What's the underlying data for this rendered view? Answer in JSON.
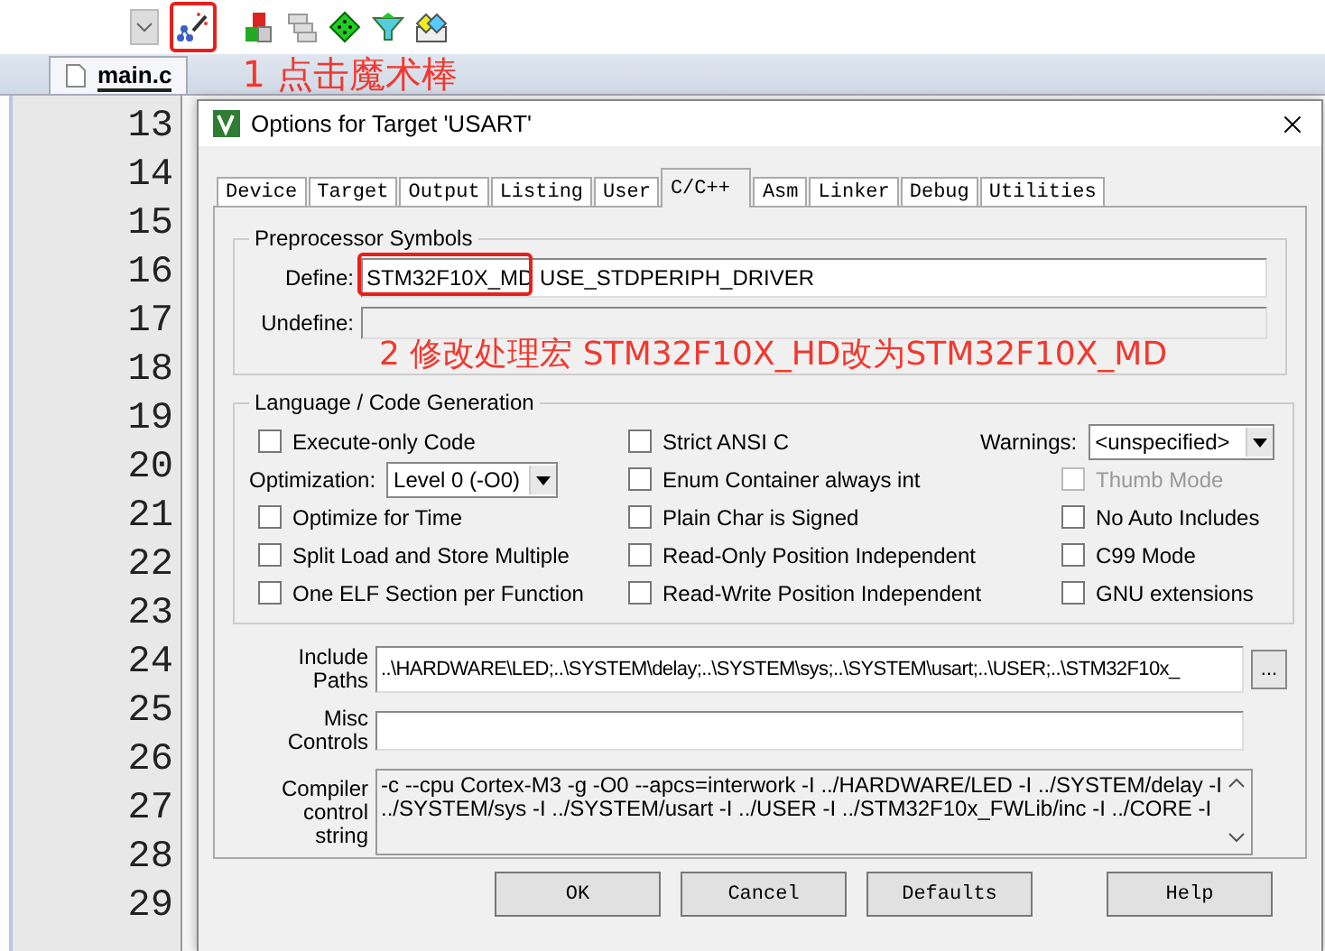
{
  "toolbar": {
    "wand_highlighted": true
  },
  "editor_tabs": [
    {
      "label": "main.c",
      "selected": true
    }
  ],
  "annotations": [
    {
      "text": "1 点击魔术棒"
    },
    {
      "text": "2 修改处理宏 STM32F10X_HD改为STM32F10X_MD"
    }
  ],
  "line_numbers": [
    "13",
    "14",
    "15",
    "16",
    "17",
    "18",
    "19",
    "20",
    "21",
    "22",
    "23",
    "24",
    "25",
    "26",
    "27",
    "28",
    "29"
  ],
  "dialog": {
    "title": "Options for Target 'USART'",
    "tabs": [
      {
        "label": "Device",
        "selected": false
      },
      {
        "label": "Target",
        "selected": false
      },
      {
        "label": "Output",
        "selected": false
      },
      {
        "label": "Listing",
        "selected": false
      },
      {
        "label": "User",
        "selected": false
      },
      {
        "label": "C/C++",
        "selected": true
      },
      {
        "label": "Asm",
        "selected": false
      },
      {
        "label": "Linker",
        "selected": false
      },
      {
        "label": "Debug",
        "selected": false
      },
      {
        "label": "Utilities",
        "selected": false
      }
    ],
    "preprocessor": {
      "title": "Preprocessor Symbols",
      "define_label": "Define:",
      "define_value": "STM32F10X_MD USE_STDPERIPH_DRIVER",
      "define_highlighted": true,
      "undefine_label": "Undefine:"
    },
    "language": {
      "title": "Language / Code Generation",
      "columns": [
        [
          {
            "kind": "checkbox",
            "label": "Execute-only Code",
            "checked": false,
            "disabled": false
          },
          {
            "kind": "select",
            "label": "Optimization:",
            "value": "Level 0 (-O0)"
          },
          {
            "kind": "checkbox",
            "label": "Optimize for Time",
            "checked": false,
            "disabled": false
          },
          {
            "kind": "checkbox",
            "label": "Split Load and Store Multiple",
            "checked": false,
            "disabled": false
          },
          {
            "kind": "checkbox",
            "label": "One ELF Section per Function",
            "checked": false,
            "disabled": false
          }
        ],
        [
          {
            "kind": "checkbox",
            "label": "Strict ANSI C",
            "checked": false,
            "disabled": false
          },
          {
            "kind": "checkbox",
            "label": "Enum Container always int",
            "checked": false,
            "disabled": false
          },
          {
            "kind": "checkbox",
            "label": "Plain Char is Signed",
            "checked": false,
            "disabled": false
          },
          {
            "kind": "checkbox",
            "label": "Read-Only Position Independent",
            "checked": false,
            "disabled": false
          },
          {
            "kind": "checkbox",
            "label": "Read-Write Position Independent",
            "checked": false,
            "disabled": false
          }
        ],
        [
          {
            "kind": "select",
            "label": "Warnings:",
            "value": "<unspecified>"
          },
          {
            "kind": "checkbox",
            "label": "Thumb Mode",
            "checked": false,
            "disabled": true
          },
          {
            "kind": "checkbox",
            "label": "No Auto Includes",
            "checked": false,
            "disabled": false
          },
          {
            "kind": "checkbox",
            "label": "C99 Mode",
            "checked": false,
            "disabled": false
          },
          {
            "kind": "checkbox",
            "label": "GNU extensions",
            "checked": false,
            "disabled": false
          }
        ]
      ]
    },
    "include": {
      "label": [
        "Include",
        "Paths"
      ],
      "value": "..\\HARDWARE\\LED;..\\SYSTEM\\delay;..\\SYSTEM\\sys;..\\SYSTEM\\usart;..\\USER;..\\STM32F10x_",
      "browse": "..."
    },
    "misc": {
      "label": [
        "Misc",
        "Controls"
      ]
    },
    "compiler": {
      "label": [
        "Compiler",
        "control",
        "string"
      ],
      "lines": [
        "-c --cpu Cortex-M3 -g -O0 --apcs=interwork -I ../HARDWARE/LED -I ../SYSTEM/delay -I",
        "../SYSTEM/sys -I ../SYSTEM/usart -I ../USER -I ../STM32F10x_FWLib/inc -I ../CORE -I"
      ]
    },
    "buttons": [
      "OK",
      "Cancel",
      "Defaults",
      "Help"
    ]
  }
}
